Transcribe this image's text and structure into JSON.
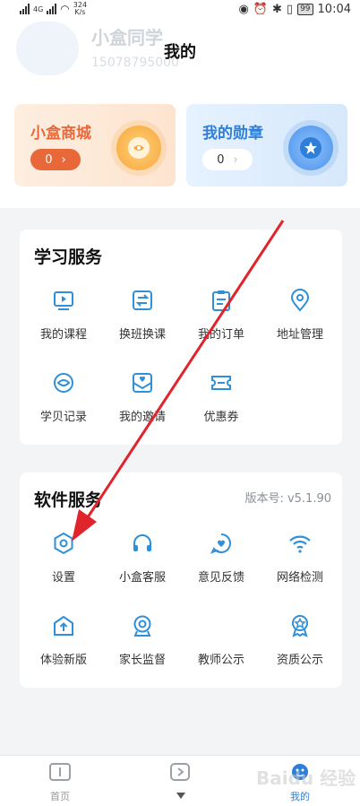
{
  "status_bar": {
    "network_left": "4G",
    "speed": "324",
    "speed_unit": "K/s",
    "battery": "99",
    "time": "10:04"
  },
  "header": {
    "title": "我的",
    "ghost_name": "小盒同学",
    "ghost_phone": "15078795000"
  },
  "cards": {
    "shop": {
      "title": "小盒商城",
      "count": "0",
      "chevron": "›"
    },
    "medal": {
      "title": "我的勋章",
      "count": "0",
      "chevron": "›"
    }
  },
  "study_services": {
    "title": "学习服务",
    "items": [
      {
        "label": "我的课程",
        "icon": "course-icon"
      },
      {
        "label": "换班换课",
        "icon": "swap-icon"
      },
      {
        "label": "我的订单",
        "icon": "order-icon"
      },
      {
        "label": "地址管理",
        "icon": "location-icon"
      },
      {
        "label": "学贝记录",
        "icon": "coin-icon"
      },
      {
        "label": "我的邀请",
        "icon": "invite-icon"
      },
      {
        "label": "优惠券",
        "icon": "coupon-icon"
      }
    ]
  },
  "software_services": {
    "title": "软件服务",
    "version": "版本号: v5.1.90",
    "items": [
      {
        "label": "设置",
        "icon": "settings-icon"
      },
      {
        "label": "小盒客服",
        "icon": "headset-icon"
      },
      {
        "label": "意见反馈",
        "icon": "feedback-icon"
      },
      {
        "label": "网络检测",
        "icon": "wifi-icon"
      },
      {
        "label": "体验新版",
        "icon": "new-version-icon"
      },
      {
        "label": "家长监督",
        "icon": "camera-icon"
      },
      {
        "label": "教师公示",
        "icon": "teacher-icon"
      },
      {
        "label": "资质公示",
        "icon": "certificate-icon"
      }
    ]
  },
  "bottom_nav": [
    {
      "label": "首页",
      "icon": "home-book-icon"
    },
    {
      "label": "",
      "icon": "play-icon"
    },
    {
      "label": "我的",
      "icon": "profile-icon"
    }
  ],
  "watermark": "Baidu 经验",
  "colors": {
    "accent_blue": "#2f7fd8",
    "shop_orange": "#e8683a",
    "icon_blue": "#2f8fd8",
    "annotation_red": "#e0242b"
  }
}
